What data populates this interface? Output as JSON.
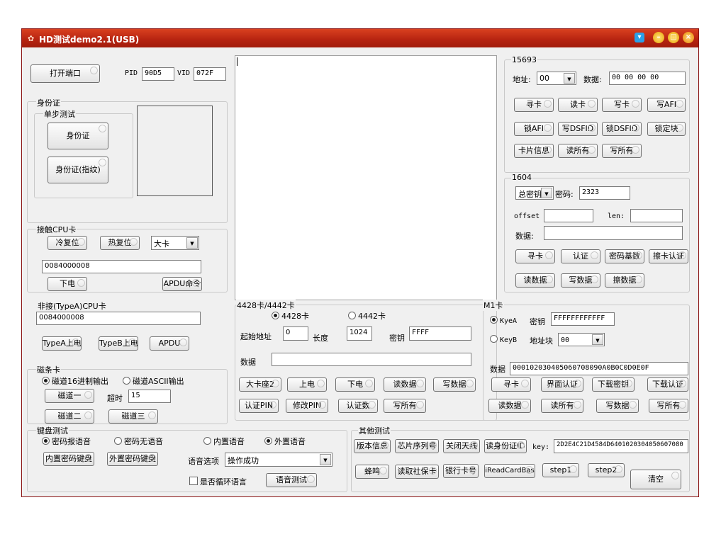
{
  "window": {
    "title": "HD测试demo2.1(USB)",
    "title_color": "#b52310",
    "controls": [
      "shirt-icon",
      "minimize-icon",
      "maximize-icon",
      "close-icon"
    ]
  },
  "top": {
    "open_port": "打开端口",
    "pid_label": "PID",
    "pid_value": "90D5",
    "vid_label": "VID",
    "vid_value": "072F"
  },
  "id_card": {
    "title": "身份证",
    "single_test": "单步测试",
    "btn_id": "身份证",
    "btn_id_fingerprint": "身份证(指纹)"
  },
  "contact_cpu": {
    "title": "接触CPU卡",
    "cold_reset": "冷复位",
    "hot_reset": "热复位",
    "card_select": "大卡",
    "apdu_value": "0084000008",
    "power_off": "下电",
    "apdu_cmd": "APDU命令"
  },
  "contactless_cpu": {
    "title": "非接(TypeA)CPU卡",
    "apdu_value": "0084000008",
    "typea_power": "TypeA上电",
    "typeb_power": "TypeB上电",
    "apdu": "APDU"
  },
  "mag_card": {
    "title": "磁条卡",
    "radio_hex": "磁道16进制输出",
    "radio_ascii": "磁道ASCII输出",
    "track1": "磁道一",
    "timeout_label": "超时",
    "timeout_value": "15",
    "track2": "磁道二",
    "track3": "磁道三"
  },
  "keypad": {
    "title": "键盘测试",
    "radio_pwd_voice": "密码报语音",
    "radio_pwd_novoice": "密码无语音",
    "radio_inner_voice": "内置语音",
    "radio_outer_voice": "外置语音",
    "inner_keypad": "内置密码键盘",
    "outer_keypad": "外置密码键盘",
    "voice_option_label": "语音选项",
    "voice_option_value": "操作成功",
    "loop_voice": "是否循环语言",
    "voice_test": "语音测试"
  },
  "card4428": {
    "title": "4428卡/4442卡",
    "radio_4428": "4428卡",
    "radio_4442": "4442卡",
    "start_addr_label": "起始地址",
    "start_addr_value": "0",
    "length_label": "长度",
    "length_value": "1024",
    "key_label": "密钥",
    "key_value": "FFFF",
    "data_label": "数据",
    "data_value": "",
    "btn_big_seat": "大卡座2",
    "btn_power_on": "上电",
    "btn_power_off": "下电",
    "btn_read": "读数据",
    "btn_write": "写数据",
    "btn_verify_pin": "认证PIN",
    "btn_modify_pin": "修改PIN",
    "btn_verify_count": "认证数",
    "btn_write_all": "写所有"
  },
  "card15693": {
    "title": "15693",
    "addr_label": "地址:",
    "addr_value": "00",
    "data_label": "数据:",
    "data_value": "00 00 00 00",
    "btn_find": "寻卡",
    "btn_read": "读卡",
    "btn_write": "写卡",
    "btn_write_afi": "写AFI",
    "btn_lock_afi": "锁AFI",
    "btn_write_dsfid": "写DSFID",
    "btn_lock_dsfid": "锁DSFID",
    "btn_lock_block": "锁定块",
    "btn_card_info": "卡片信息",
    "btn_read_all": "读所有",
    "btn_write_all": "写所有"
  },
  "card1604": {
    "title": "1604",
    "key_type": "总密钥",
    "pwd_label": "密码:",
    "pwd_value": "2323",
    "offset_label": "offset",
    "offset_value": "",
    "len_label": "len:",
    "len_value": "",
    "data_label": "数据:",
    "data_value": "",
    "btn_find": "寻卡",
    "btn_auth": "认证",
    "btn_pwd_count": "密码基数",
    "btn_erase_auth": "擦卡认证",
    "btn_read": "读数据",
    "btn_write": "写数据",
    "btn_erase": "擦数据"
  },
  "m1": {
    "title": "M1卡",
    "radio_keya": "KyeA",
    "radio_keyb": "KeyB",
    "key_label": "密钥",
    "key_value": "FFFFFFFFFFFF",
    "block_label": "地址块",
    "block_value": "00",
    "data_label": "数据",
    "data_value": "000102030405060708090A0B0C0D0E0F",
    "btn_find": "寻卡",
    "btn_ui_auth": "界面认证",
    "btn_download_key": "下载密钥",
    "btn_download_auth": "下载认证",
    "btn_read": "读数据",
    "btn_read_all": "读所有",
    "btn_write": "写数据",
    "btn_write_all": "写所有"
  },
  "other": {
    "title": "其他测试",
    "btn_version": "版本信息",
    "btn_chip_serial": "芯片序列号",
    "btn_close_antenna": "关闭天线",
    "btn_read_id": "读身份证ID",
    "key_label": "key:",
    "key_value": "2D2E4C21D4584D6401020304050607080",
    "btn_beep": "蜂鸣",
    "btn_social_card": "读取社保卡",
    "btn_bank_card": "银行卡号",
    "btn_iread": "iReadCardBas",
    "btn_step1": "step1",
    "btn_step2": "step2",
    "btn_clear": "清空"
  },
  "output": {
    "text": ""
  }
}
